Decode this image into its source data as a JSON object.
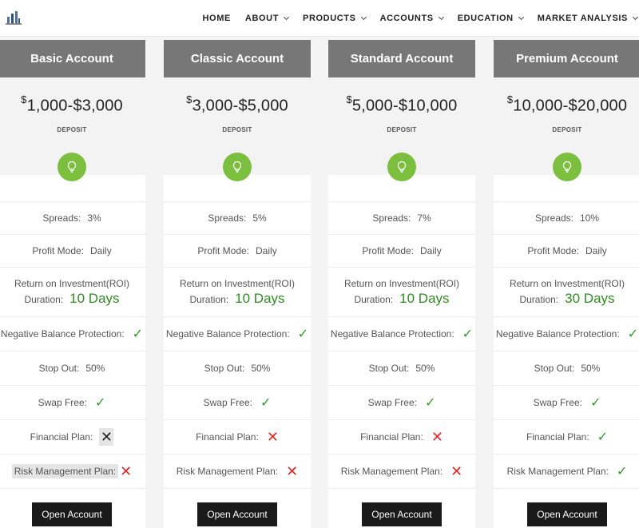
{
  "nav": {
    "logo_icon": "building-chart-icon",
    "items": [
      {
        "label": "HOME",
        "dropdown": false
      },
      {
        "label": "ABOUT",
        "dropdown": true
      },
      {
        "label": "PRODUCTS",
        "dropdown": true
      },
      {
        "label": "ACCOUNTS",
        "dropdown": true
      },
      {
        "label": "EDUCATION",
        "dropdown": true
      },
      {
        "label": "MARKET ANALYSIS",
        "dropdown": true
      }
    ]
  },
  "colors": {
    "header_gray": "#777777",
    "accent_green": "#7cbf3e",
    "check_green": "#2f9a28",
    "cross_red": "#e02a2a",
    "button_black": "#1a1a1a"
  },
  "labels": {
    "deposit": "DEPOSIT",
    "spreads": "Spreads:",
    "profit_mode": "Profit Mode:",
    "roi": "Return on Investment(ROI)",
    "duration": "Duration:",
    "negative_balance": "Negative Balance Protection:",
    "stop_out": "Stop Out:",
    "swap_free": "Swap Free:",
    "financial_plan": "Financial Plan:",
    "risk_management": "Risk Management Plan:",
    "button": "Open Account"
  },
  "plans": [
    {
      "name": "Basic Account",
      "currency": "$",
      "range": "1,000-$3,000",
      "spreads": "3%",
      "profit_mode": "Daily",
      "duration": "10 Days",
      "negative_balance": true,
      "stop_out": "50%",
      "swap_free": true,
      "financial_plan": false,
      "risk_management": false
    },
    {
      "name": "Classic Account",
      "currency": "$",
      "range": "3,000-$5,000",
      "spreads": "5%",
      "profit_mode": "Daily",
      "duration": "10 Days",
      "negative_balance": true,
      "stop_out": "50%",
      "swap_free": true,
      "financial_plan": false,
      "risk_management": false
    },
    {
      "name": "Standard Account",
      "currency": "$",
      "range": "5,000-$10,000",
      "spreads": "7%",
      "profit_mode": "Daily",
      "duration": "10 Days",
      "negative_balance": true,
      "stop_out": "50%",
      "swap_free": true,
      "financial_plan": false,
      "risk_management": false
    },
    {
      "name": "Premium Account",
      "currency": "$",
      "range": "10,000-$20,000",
      "spreads": "10%",
      "profit_mode": "Daily",
      "duration": "30 Days",
      "negative_balance": true,
      "stop_out": "50%",
      "swap_free": true,
      "financial_plan": true,
      "risk_management": true
    }
  ]
}
